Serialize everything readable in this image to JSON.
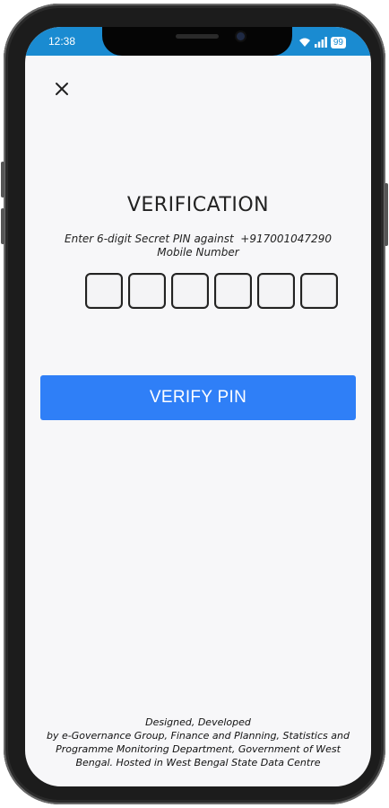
{
  "status_bar": {
    "time": "12:38",
    "battery": "99",
    "icons": [
      "wifi-icon",
      "signal-icon",
      "battery-icon"
    ]
  },
  "header": {
    "close_icon": "close-icon"
  },
  "verification": {
    "title": "VERIFICATION",
    "instruction_line1": "Enter 6-digit Secret PIN against  +917001047290",
    "instruction_line2": "Mobile Number",
    "pin_boxes": [
      "",
      "",
      "",
      "",
      "",
      ""
    ],
    "verify_label": "VERIFY PIN"
  },
  "footer": {
    "line1": "Designed, Developed",
    "line2": "by e-Governance Group, Finance and Planning, Statistics and",
    "line3": "Programme Monitoring Department, Government of West",
    "line4": "Bengal. Hosted in West Bengal State Data Centre"
  },
  "colors": {
    "status_bar": "#1a8bd1",
    "button": "#2f7ff7",
    "screen_bg": "#f7f7f9"
  }
}
